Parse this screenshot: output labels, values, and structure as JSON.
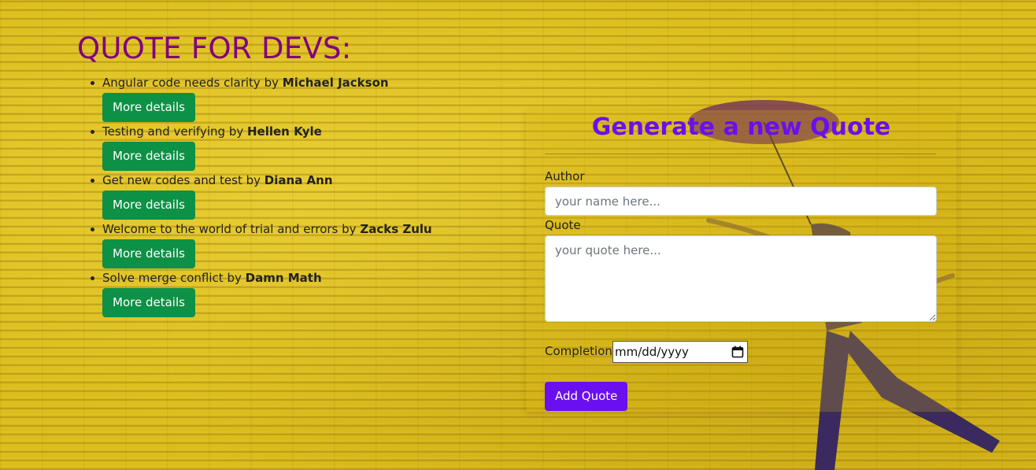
{
  "page": {
    "heading": "QUOTE FOR DEVS:"
  },
  "quotes": [
    {
      "text": "Angular code needs clarity",
      "by": "by",
      "author": "Michael Jackson",
      "button": "More details"
    },
    {
      "text": "Testing and verifying",
      "by": "by",
      "author": "Hellen Kyle",
      "button": "More details"
    },
    {
      "text": "Get new codes and test",
      "by": "by",
      "author": "Diana Ann",
      "button": "More details"
    },
    {
      "text": "Welcome to the world of trial and errors",
      "by": "by",
      "author": "Zacks Zulu",
      "button": "More details"
    },
    {
      "text": "Solve merge conflict",
      "by": "by",
      "author": "Damn Math",
      "button": "More details"
    }
  ],
  "form": {
    "title": "Generate a new Quote",
    "author_label": "Author",
    "author_placeholder": "your name here...",
    "author_value": "",
    "quote_label": "Quote",
    "quote_placeholder": "your quote here...",
    "quote_value": "",
    "completion_label": "Completion",
    "date_placeholder": "mm/dd/yyyy",
    "submit_label": "Add Quote"
  },
  "colors": {
    "heading": "#800080",
    "form_title": "#6a0ff0",
    "details_button": "#0d9146",
    "add_button": "#6a0ff0",
    "background": "#dcbd1e"
  },
  "icons": {
    "date_picker": "calendar-icon"
  }
}
